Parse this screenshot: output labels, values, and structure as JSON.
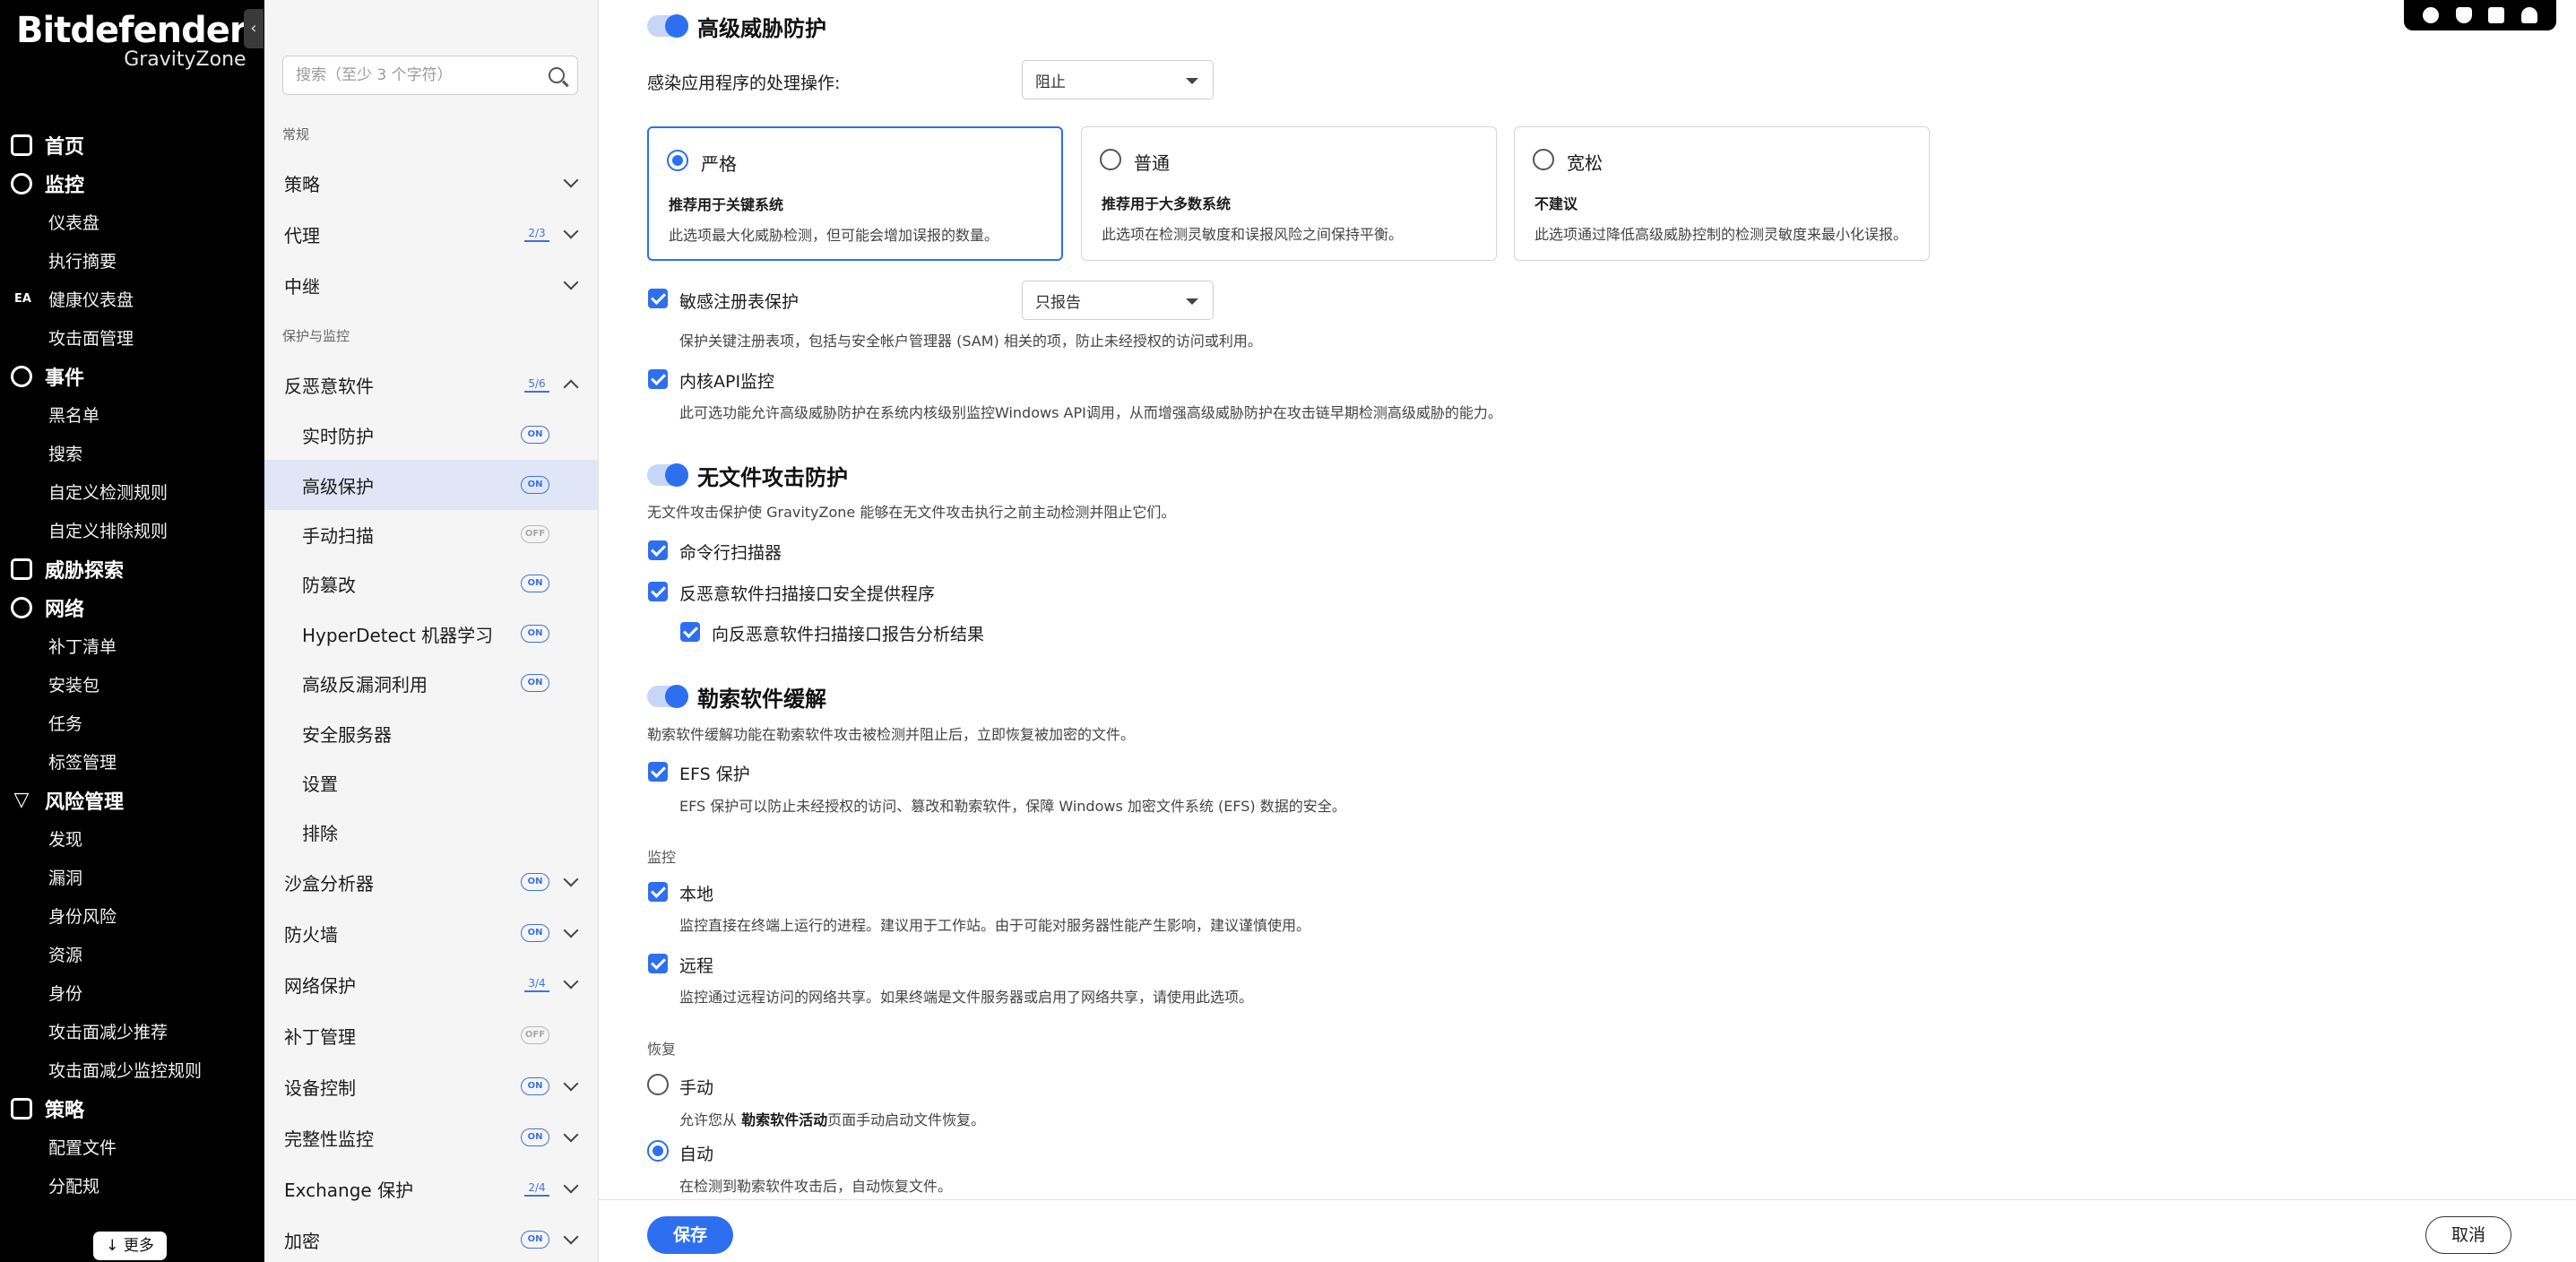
{
  "brand": {
    "name": "Bitdefender",
    "product": "GravityZone"
  },
  "nav": {
    "groups": [
      {
        "label": "首页",
        "items": []
      },
      {
        "label": "监控",
        "items": [
          "仪表盘",
          "执行摘要",
          "健康仪表盘",
          "攻击面管理"
        ]
      },
      {
        "label": "事件",
        "items": [
          "黑名单",
          "搜索",
          "自定义检测规则",
          "自定义排除规则"
        ]
      },
      {
        "label": "威胁探索",
        "items": []
      },
      {
        "label": "网络",
        "items": [
          "补丁清单",
          "安装包",
          "任务",
          "标签管理"
        ]
      },
      {
        "label": "风险管理",
        "items": [
          "发现",
          "漏洞",
          "身份风险",
          "资源",
          "身份",
          "攻击面减少推荐",
          "攻击面减少监控规则"
        ]
      },
      {
        "label": "策略",
        "items": [
          "配置文件",
          "分配规"
        ]
      }
    ],
    "ea_badge": "EA",
    "more_label": "更多"
  },
  "subnav": {
    "search_placeholder": "搜索（至少 3 个字符）",
    "section_general": "常规",
    "general_items": [
      {
        "label": "策略",
        "frac": ""
      },
      {
        "label": "代理",
        "frac": "2/3"
      },
      {
        "label": "中继",
        "frac": ""
      }
    ],
    "section_protection": "保护与监控",
    "antimalware": {
      "label": "反恶意软件",
      "frac": "5/6"
    },
    "antimalware_children": [
      {
        "label": "实时防护",
        "status": "ON"
      },
      {
        "label": "高级保护",
        "status": "ON"
      },
      {
        "label": "手动扫描",
        "status": "OFF"
      },
      {
        "label": "防篡改",
        "status": "ON"
      },
      {
        "label": "HyperDetect 机器学习",
        "status": "ON"
      },
      {
        "label": "高级反漏洞利用",
        "status": "ON"
      },
      {
        "label": "安全服务器",
        "status": ""
      },
      {
        "label": "设置",
        "status": ""
      },
      {
        "label": "排除",
        "status": ""
      }
    ],
    "modules": [
      {
        "label": "沙盒分析器",
        "status": "ON",
        "frac": ""
      },
      {
        "label": "防火墙",
        "status": "ON",
        "frac": ""
      },
      {
        "label": "网络保护",
        "status": "",
        "frac": "3/4"
      },
      {
        "label": "补丁管理",
        "status": "OFF",
        "frac": ""
      },
      {
        "label": "设备控制",
        "status": "ON",
        "frac": ""
      },
      {
        "label": "完整性监控",
        "status": "ON",
        "frac": ""
      },
      {
        "label": "Exchange 保护",
        "status": "",
        "frac": "2/4"
      },
      {
        "label": "加密",
        "status": "ON",
        "frac": ""
      }
    ]
  },
  "main": {
    "atp": {
      "title": "高级威胁防护",
      "action_label": "感染应用程序的处理操作:",
      "action_value": "阻止",
      "levels": [
        {
          "title": "严格",
          "subtitle": "推荐用于关键系统",
          "desc": "此选项最大化威胁检测，但可能会增加误报的数量。",
          "selected": true
        },
        {
          "title": "普通",
          "subtitle": "推荐用于大多数系统",
          "desc": "此选项在检测灵敏度和误报风险之间保持平衡。",
          "selected": false
        },
        {
          "title": "宽松",
          "subtitle": "不建议",
          "desc": "此选项通过降低高级威胁控制的检测灵敏度来最小化误报。",
          "selected": false
        }
      ],
      "registry_label": "敏感注册表保护",
      "registry_value": "只报告",
      "registry_desc": "保护关键注册表项，包括与安全帐户管理器 (SAM) 相关的项，防止未经授权的访问或利用。",
      "kernel_label": "内核API监控",
      "kernel_desc": "此可选功能允许高级威胁防护在系统内核级别监控Windows API调用，从而增强高级威胁防护在攻击链早期检测高级威胁的能力。"
    },
    "fileless": {
      "title": "无文件攻击防护",
      "desc": "无文件攻击保护使 GravityZone 能够在无文件攻击执行之前主动检测并阻止它们。",
      "cmd_label": "命令行扫描器",
      "amsi_label": "反恶意软件扫描接口安全提供程序",
      "amsi_report_label": "向反恶意软件扫描接口报告分析结果"
    },
    "ransomware": {
      "title": "勒索软件缓解",
      "desc": "勒索软件缓解功能在勒索软件攻击被检测并阻止后，立即恢复被加密的文件。",
      "efs_label": "EFS 保护",
      "efs_desc": "EFS 保护可以防止未经授权的访问、篡改和勒索软件，保障 Windows 加密文件系统 (EFS) 数据的安全。",
      "monitor_label": "监控",
      "local_label": "本地",
      "local_desc": "监控直接在终端上运行的进程。建议用于工作站。由于可能对服务器性能产生影响，建议谨慎使用。",
      "remote_label": "远程",
      "remote_desc": "监控通过远程访问的网络共享。如果终端是文件服务器或启用了网络共享，请使用此选项。",
      "recovery_label": "恢复",
      "manual_label": "手动",
      "manual_desc_prefix": "允许您从 ",
      "manual_desc_link": "勒索软件活动",
      "manual_desc_suffix": "页面手动启动文件恢复。",
      "auto_label": "自动",
      "auto_desc": "在检测到勒索软件攻击后，自动恢复文件。"
    }
  },
  "footer": {
    "save_label": "保存",
    "cancel_label": "取消"
  },
  "colors": {
    "accent": "#2e6ff0",
    "nav_bg": "#000000",
    "active_row": "#e0e6f6"
  }
}
